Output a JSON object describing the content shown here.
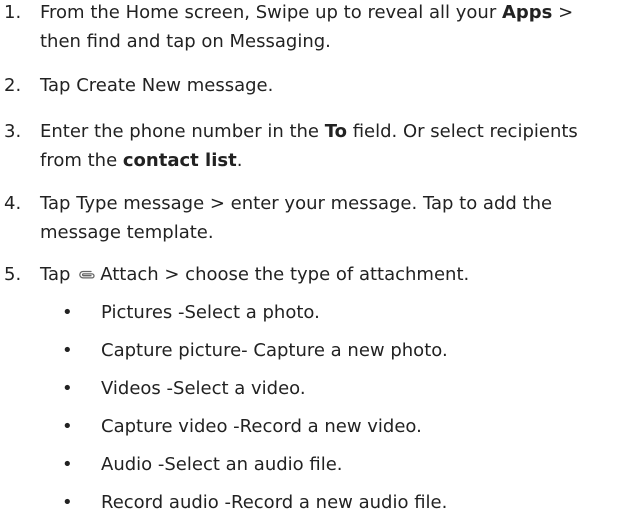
{
  "steps": [
    {
      "number": "1.",
      "line1_pre": "From the Home screen, Swipe up to reveal all your ",
      "line1_bold": "Apps",
      "line1_post": " >",
      "line2": "then find and tap on Messaging."
    },
    {
      "number": "2.",
      "text": "Tap Create New message."
    },
    {
      "number": "3.",
      "line1_pre": "Enter the phone number in the ",
      "line1_bold": "To",
      "line1_post": " field. Or select recipients",
      "line2_pre": "from the ",
      "line2_bold": "contact list",
      "line2_post": "."
    },
    {
      "number": "4.",
      "line1": "Tap Type message > enter your message. Tap to add the",
      "line2": "message template."
    },
    {
      "number": "5.",
      "pre": "Tap ",
      "icon": "paperclip-icon",
      "post": "Attach > choose the type of attachment."
    }
  ],
  "attachment_types": [
    {
      "bullet": "•",
      "text": "Pictures -Select a photo."
    },
    {
      "bullet": "•",
      "text": "Capture picture- Capture a new photo."
    },
    {
      "bullet": "•",
      "text": "Videos -Select a video."
    },
    {
      "bullet": "•",
      "text": "Capture video -Record a new video."
    },
    {
      "bullet": "•",
      "text": "Audio -Select an audio file."
    },
    {
      "bullet": "•",
      "text": "Record audio -Record a new audio file."
    }
  ],
  "colors": {
    "text": "#222222",
    "background": "#ffffff",
    "icon": "#666666"
  }
}
